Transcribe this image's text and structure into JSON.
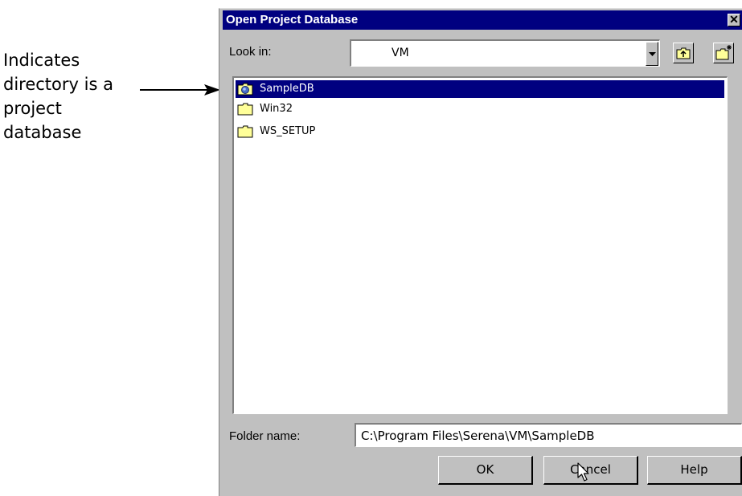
{
  "annotation": {
    "lines": [
      "Indicates",
      "directory is a",
      "project",
      "database"
    ]
  },
  "dialog": {
    "title": "Open Project Database",
    "close_glyph": "✕",
    "look_in_label": "Look in:",
    "look_in_value": "VM",
    "toolbar_icons": [
      "up-one-level-icon",
      "new-folder-icon"
    ],
    "files": [
      {
        "name": "SampleDB",
        "icon": "project-database-folder-icon",
        "selected": true
      },
      {
        "name": "Win32",
        "icon": "folder-icon",
        "selected": false
      },
      {
        "name": "WS_SETUP",
        "icon": "folder-icon",
        "selected": false
      }
    ],
    "folder_name_label": "Folder name:",
    "folder_name_value": "C:\\Program Files\\Serena\\VM\\SampleDB",
    "buttons": {
      "ok": "OK",
      "cancel": "Cancel",
      "help": "Help"
    }
  },
  "colors": {
    "title_bar": "#000080",
    "selection": "#000080",
    "dialog_face": "#c0c0c0",
    "folder_fill": "#ffff99"
  }
}
